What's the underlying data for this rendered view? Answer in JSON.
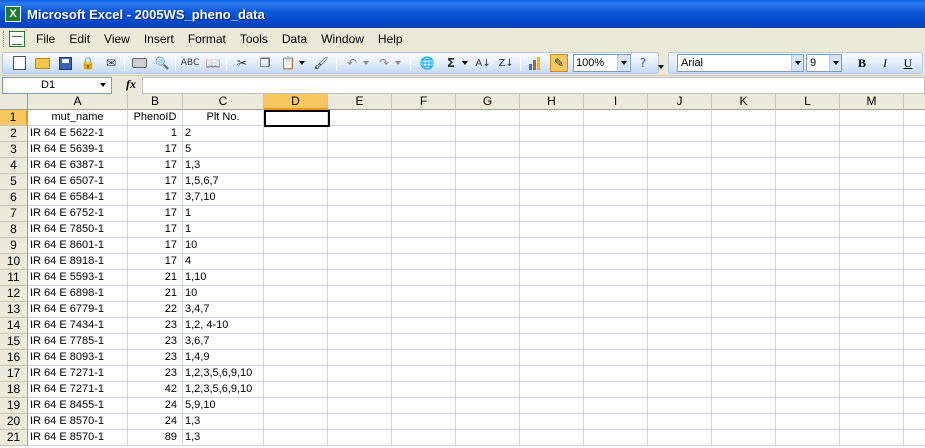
{
  "window": {
    "title": "Microsoft Excel - 2005WS_pheno_data"
  },
  "menu": [
    "File",
    "Edit",
    "View",
    "Insert",
    "Format",
    "Tools",
    "Data",
    "Window",
    "Help"
  ],
  "toolbar": {
    "zoom": "100%",
    "font": "Arial",
    "font_size": "9",
    "bold": "B",
    "italic": "I",
    "underline": "U",
    "sigma": "Σ"
  },
  "formula_bar": {
    "name_box": "D1",
    "fx": "fx",
    "content": ""
  },
  "columns": [
    "A",
    "B",
    "C",
    "D",
    "E",
    "F",
    "G",
    "H",
    "I",
    "J",
    "K",
    "L",
    "M"
  ],
  "selected_column": "D",
  "rows": [
    {
      "n": "1",
      "a": "mut_name",
      "b": "PhenoID",
      "c": "Plt No."
    },
    {
      "n": "2",
      "a": "IR 64 E 5622-1",
      "b": "1",
      "c": "2"
    },
    {
      "n": "3",
      "a": "IR 64 E 5639-1",
      "b": "17",
      "c": "5"
    },
    {
      "n": "4",
      "a": "IR 64 E 6387-1",
      "b": "17",
      "c": "1,3"
    },
    {
      "n": "5",
      "a": "IR 64 E 6507-1",
      "b": "17",
      "c": "1,5,6,7"
    },
    {
      "n": "6",
      "a": "IR 64 E 6584-1",
      "b": "17",
      "c": "3,7,10"
    },
    {
      "n": "7",
      "a": "IR 64 E 6752-1",
      "b": "17",
      "c": "1"
    },
    {
      "n": "8",
      "a": "IR 64 E 7850-1",
      "b": "17",
      "c": "1"
    },
    {
      "n": "9",
      "a": "IR 64 E 8601-1",
      "b": "17",
      "c": "10"
    },
    {
      "n": "10",
      "a": "IR 64 E 8918-1",
      "b": "17",
      "c": "4"
    },
    {
      "n": "11",
      "a": "IR 64 E 5593-1",
      "b": "21",
      "c": "1,10"
    },
    {
      "n": "12",
      "a": "IR 64 E 6898-1",
      "b": "21",
      "c": "10"
    },
    {
      "n": "13",
      "a": "IR 64 E 6779-1",
      "b": "22",
      "c": "3,4,7"
    },
    {
      "n": "14",
      "a": "IR 64 E 7434-1",
      "b": "23",
      "c": "1,2, 4-10"
    },
    {
      "n": "15",
      "a": "IR 64 E 7785-1",
      "b": "23",
      "c": "3,6,7"
    },
    {
      "n": "16",
      "a": "IR 64 E 8093-1",
      "b": "23",
      "c": "1,4,9"
    },
    {
      "n": "17",
      "a": "IR 64 E 7271-1",
      "b": "23",
      "c": "1,2,3,5,6,9,10"
    },
    {
      "n": "18",
      "a": "IR 64 E 7271-1",
      "b": "42",
      "c": "1,2,3,5,6,9,10"
    },
    {
      "n": "19",
      "a": "IR 64 E 8455-1",
      "b": "24",
      "c": "5,9,10"
    },
    {
      "n": "20",
      "a": "IR 64 E 8570-1",
      "b": "24",
      "c": "1,3"
    },
    {
      "n": "21",
      "a": "IR 64 E 8570-1",
      "b": "89",
      "c": "1,3"
    }
  ]
}
